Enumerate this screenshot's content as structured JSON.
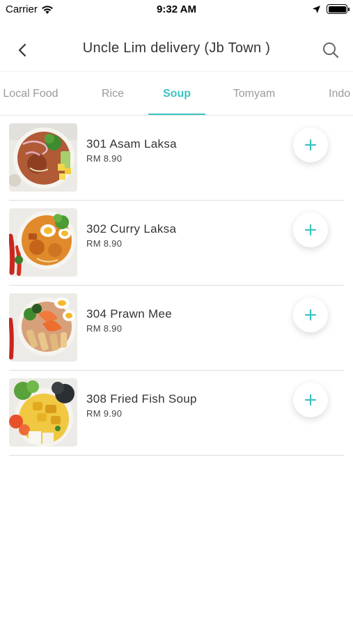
{
  "status_bar": {
    "carrier": "Carrier",
    "time": "9:32 AM"
  },
  "header": {
    "title": "Uncle Lim delivery (Jb Town )",
    "back_icon": "chevron-left-icon",
    "search_icon": "search-icon"
  },
  "tabs": [
    {
      "label": "Local Food",
      "active": false
    },
    {
      "label": "Rice",
      "active": false
    },
    {
      "label": "Soup",
      "active": true
    },
    {
      "label": "Tomyam",
      "active": false
    },
    {
      "label": "Indo",
      "active": false
    }
  ],
  "accent_color": "#3cc3c0",
  "items": [
    {
      "name": "301 Asam Laksa",
      "price": "RM 8.90"
    },
    {
      "name": "302 Curry Laksa",
      "price": "RM 8.90"
    },
    {
      "name": "304 Prawn Mee",
      "price": "RM 8.90"
    },
    {
      "name": "308 Fried Fish Soup",
      "price": "RM 9.90"
    }
  ]
}
